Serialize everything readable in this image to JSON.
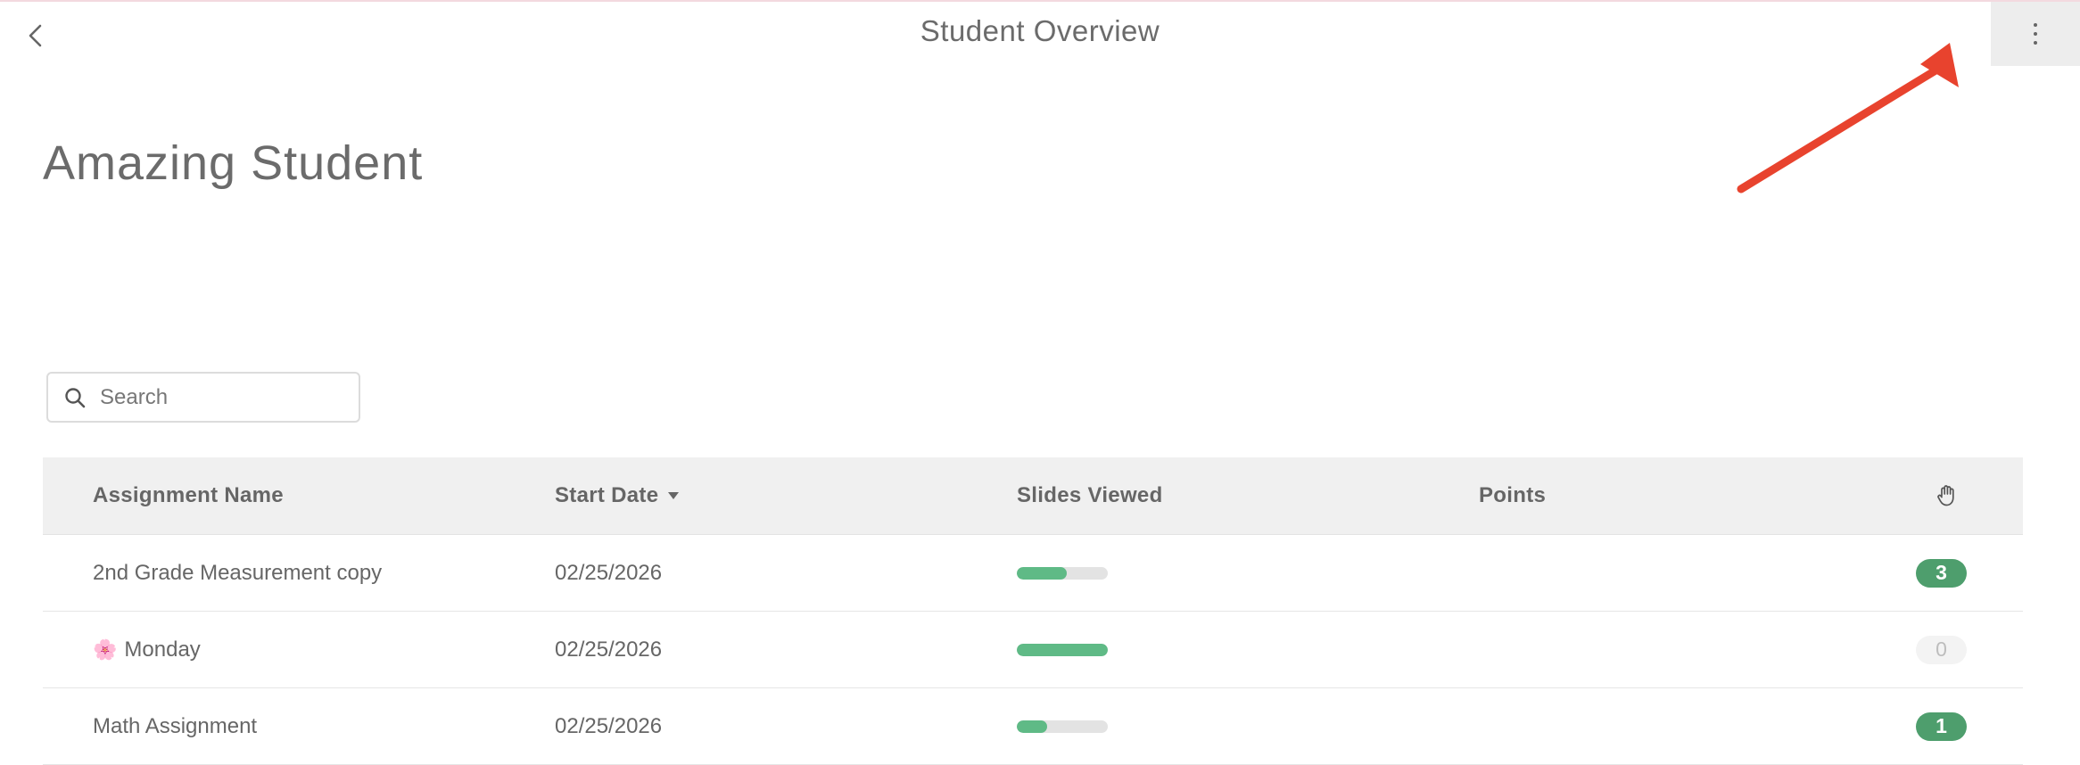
{
  "header": {
    "title": "Student Overview",
    "back_icon": "chevron-left-icon",
    "more_icon": "vertical-dots-icon"
  },
  "student": {
    "name": "Amazing Student"
  },
  "search": {
    "placeholder": "Search",
    "value": ""
  },
  "table": {
    "columns": {
      "name": "Assignment Name",
      "start_date": "Start Date",
      "slides_viewed": "Slides Viewed",
      "points": "Points",
      "hand_icon": "raised-hand-icon"
    },
    "sort": {
      "column": "start_date",
      "direction": "descending"
    },
    "rows": [
      {
        "name": "2nd Grade Measurement copy",
        "emoji": "",
        "start_date": "02/25/2026",
        "slides_progress": 0.55,
        "points": "",
        "hand_count": "3",
        "hand_active": true
      },
      {
        "name": "Monday",
        "emoji": "🌸",
        "start_date": "02/25/2026",
        "slides_progress": 1.0,
        "points": "",
        "hand_count": "0",
        "hand_active": false
      },
      {
        "name": "Math Assignment",
        "emoji": "",
        "start_date": "02/25/2026",
        "slides_progress": 0.33,
        "points": "",
        "hand_count": "1",
        "hand_active": true
      }
    ]
  },
  "colors": {
    "progress_fill": "#5fba86",
    "progress_track": "#e3e3e3",
    "badge_active": "#4e9e6d",
    "annotation_arrow": "#e8432e"
  }
}
